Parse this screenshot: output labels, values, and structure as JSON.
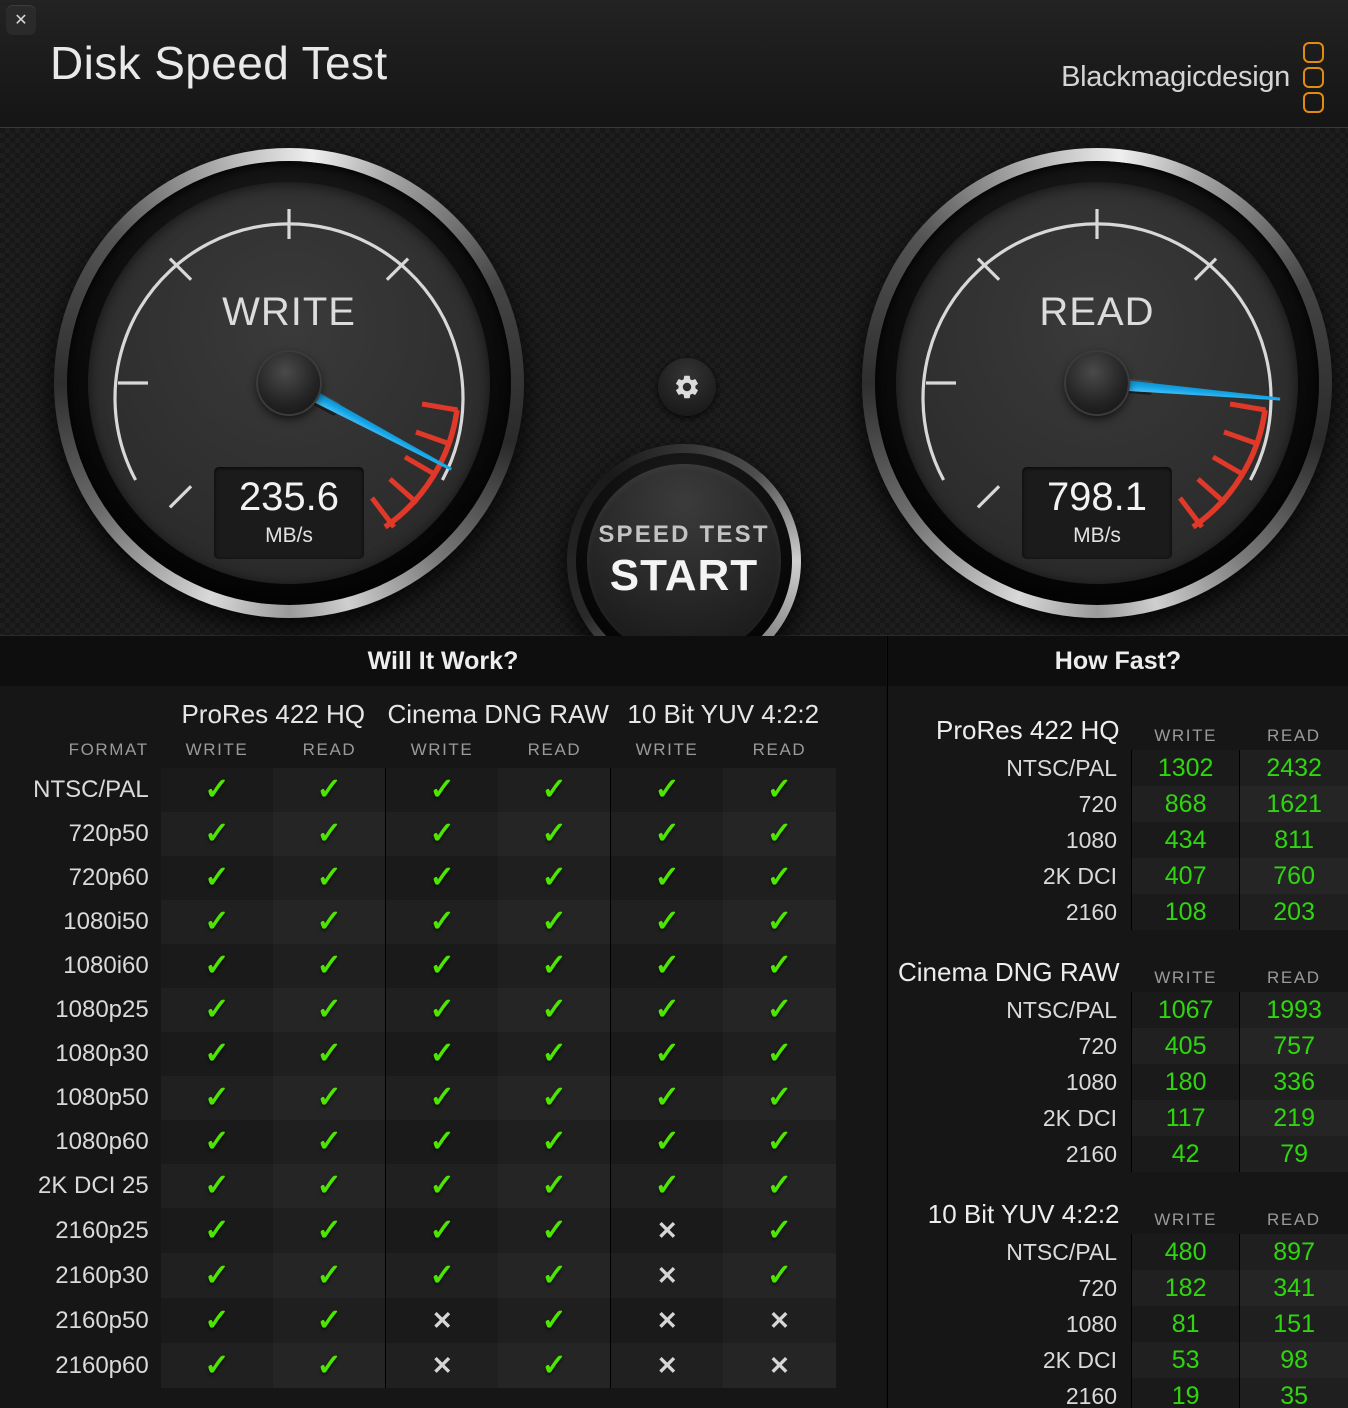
{
  "window": {
    "title": "Disk Speed Test",
    "close_label": "✕"
  },
  "brand": {
    "text": "Blackmagicdesign",
    "accent": "#e08c12"
  },
  "gauges": {
    "write": {
      "label": "WRITE",
      "value": "235.6",
      "unit": "MB/s",
      "needle_deg": 208
    },
    "read": {
      "label": "READ",
      "value": "798.1",
      "unit": "MB/s",
      "needle_deg": 185
    }
  },
  "start_button": {
    "sub_label": "SPEED TEST",
    "main_label": "START"
  },
  "settings_button": {
    "icon": "gear-icon"
  },
  "will_it_work": {
    "title": "Will It Work?",
    "format_header": "FORMAT",
    "codecs": [
      "ProRes 422 HQ",
      "Cinema DNG RAW",
      "10 Bit YUV 4:2:2"
    ],
    "sub_headers": [
      "WRITE",
      "READ"
    ],
    "check_glyph": "✓",
    "cross_glyph": "✕",
    "rows": [
      {
        "format": "NTSC/PAL",
        "cells": [
          true,
          true,
          true,
          true,
          true,
          true
        ]
      },
      {
        "format": "720p50",
        "cells": [
          true,
          true,
          true,
          true,
          true,
          true
        ]
      },
      {
        "format": "720p60",
        "cells": [
          true,
          true,
          true,
          true,
          true,
          true
        ]
      },
      {
        "format": "1080i50",
        "cells": [
          true,
          true,
          true,
          true,
          true,
          true
        ]
      },
      {
        "format": "1080i60",
        "cells": [
          true,
          true,
          true,
          true,
          true,
          true
        ]
      },
      {
        "format": "1080p25",
        "cells": [
          true,
          true,
          true,
          true,
          true,
          true
        ]
      },
      {
        "format": "1080p30",
        "cells": [
          true,
          true,
          true,
          true,
          true,
          true
        ]
      },
      {
        "format": "1080p50",
        "cells": [
          true,
          true,
          true,
          true,
          true,
          true
        ]
      },
      {
        "format": "1080p60",
        "cells": [
          true,
          true,
          true,
          true,
          true,
          true
        ]
      },
      {
        "format": "2K DCI 25",
        "cells": [
          true,
          true,
          true,
          true,
          true,
          true
        ]
      },
      {
        "format": "2160p25",
        "cells": [
          true,
          true,
          true,
          true,
          false,
          true
        ]
      },
      {
        "format": "2160p30",
        "cells": [
          true,
          true,
          true,
          true,
          false,
          true
        ]
      },
      {
        "format": "2160p50",
        "cells": [
          true,
          true,
          false,
          true,
          false,
          false
        ]
      },
      {
        "format": "2160p60",
        "cells": [
          true,
          true,
          false,
          true,
          false,
          false
        ]
      }
    ]
  },
  "how_fast": {
    "title": "How Fast?",
    "sub_headers": [
      "WRITE",
      "READ"
    ],
    "groups": [
      {
        "name": "ProRes 422 HQ",
        "rows": [
          {
            "format": "NTSC/PAL",
            "write": "1302",
            "read": "2432"
          },
          {
            "format": "720",
            "write": "868",
            "read": "1621"
          },
          {
            "format": "1080",
            "write": "434",
            "read": "811"
          },
          {
            "format": "2K DCI",
            "write": "407",
            "read": "760"
          },
          {
            "format": "2160",
            "write": "108",
            "read": "203"
          }
        ]
      },
      {
        "name": "Cinema DNG RAW",
        "rows": [
          {
            "format": "NTSC/PAL",
            "write": "1067",
            "read": "1993"
          },
          {
            "format": "720",
            "write": "405",
            "read": "757"
          },
          {
            "format": "1080",
            "write": "180",
            "read": "336"
          },
          {
            "format": "2K DCI",
            "write": "117",
            "read": "219"
          },
          {
            "format": "2160",
            "write": "42",
            "read": "79"
          }
        ]
      },
      {
        "name": "10 Bit YUV 4:2:2",
        "rows": [
          {
            "format": "NTSC/PAL",
            "write": "480",
            "read": "897"
          },
          {
            "format": "720",
            "write": "182",
            "read": "341"
          },
          {
            "format": "1080",
            "write": "81",
            "read": "151"
          },
          {
            "format": "2K DCI",
            "write": "53",
            "read": "98"
          },
          {
            "format": "2160",
            "write": "19",
            "read": "35"
          }
        ]
      }
    ]
  },
  "colors": {
    "check_green": "#4ce600",
    "value_green": "#2fd60f",
    "needle_blue": "#15a6e8",
    "warn_red": "#e0392a",
    "brand_orange": "#e08c12"
  }
}
